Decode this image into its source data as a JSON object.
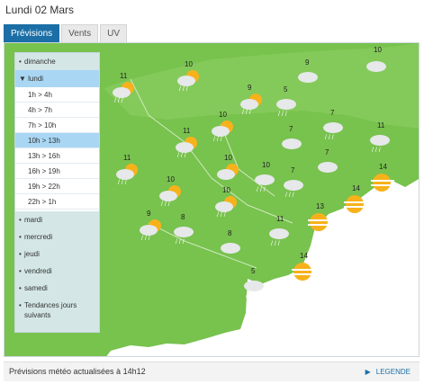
{
  "header": {
    "title": "Lundi 02 Mars"
  },
  "tabs": [
    {
      "label": "Prévisions",
      "active": true
    },
    {
      "label": "Vents",
      "active": false
    },
    {
      "label": "UV",
      "active": false
    }
  ],
  "sidebar": {
    "before": [
      {
        "label": "dimanche"
      }
    ],
    "open_day": {
      "label": "lundi",
      "marker": "▼"
    },
    "slots": [
      {
        "label": "1h > 4h"
      },
      {
        "label": "4h > 7h"
      },
      {
        "label": "7h > 10h"
      },
      {
        "label": "10h > 13h",
        "selected": true
      },
      {
        "label": "13h > 16h"
      },
      {
        "label": "16h > 19h"
      },
      {
        "label": "19h > 22h"
      },
      {
        "label": "22h > 1h"
      }
    ],
    "after": [
      {
        "label": "mardi"
      },
      {
        "label": "mercredi"
      },
      {
        "label": "jeudi"
      },
      {
        "label": "vendredi"
      },
      {
        "label": "samedi"
      },
      {
        "label": "Tendances jours suivants"
      }
    ]
  },
  "map": {
    "colors": {
      "land": "#78c24e",
      "land_shade": "#8ccf63",
      "sea": "#ffffff",
      "river": "#cfe9bd"
    },
    "forecasts": [
      {
        "temp": "11",
        "icon": "sun-cloud-rain"
      },
      {
        "temp": "10",
        "icon": "sun-cloud-rain"
      },
      {
        "temp": "9",
        "icon": "cloud"
      },
      {
        "temp": "10",
        "icon": "cloud"
      },
      {
        "temp": "9",
        "icon": "sun-cloud-rain"
      },
      {
        "temp": "5",
        "icon": "cloud-rain"
      },
      {
        "temp": "11",
        "icon": "sun-cloud-rain"
      },
      {
        "temp": "10",
        "icon": "sun-cloud-rain"
      },
      {
        "temp": "7",
        "icon": "cloud-rain"
      },
      {
        "temp": "7",
        "icon": "cloud"
      },
      {
        "temp": "11",
        "icon": "cloud-rain"
      },
      {
        "temp": "11",
        "icon": "sun-cloud-rain"
      },
      {
        "temp": "10",
        "icon": "sun-cloud"
      },
      {
        "temp": "10",
        "icon": "cloud-rain"
      },
      {
        "temp": "7",
        "icon": "cloud-rain"
      },
      {
        "temp": "7",
        "icon": "cloud"
      },
      {
        "temp": "14",
        "icon": "haze"
      },
      {
        "temp": "10",
        "icon": "sun-cloud-rain"
      },
      {
        "temp": "10",
        "icon": "sun-cloud-rain"
      },
      {
        "temp": "14",
        "icon": "haze"
      },
      {
        "temp": "9",
        "icon": "sun-cloud-rain"
      },
      {
        "temp": "8",
        "icon": "cloud-rain"
      },
      {
        "temp": "11",
        "icon": "cloud-rain"
      },
      {
        "temp": "13",
        "icon": "haze"
      },
      {
        "temp": "8",
        "icon": "cloud"
      },
      {
        "temp": "14",
        "icon": "haze"
      },
      {
        "temp": "5",
        "icon": "cloud-rain"
      }
    ]
  },
  "footer": {
    "update_text": "Prévisions météo actualisées à 14h12",
    "legend_arrow": "▶",
    "legend_label": "LEGENDE"
  }
}
